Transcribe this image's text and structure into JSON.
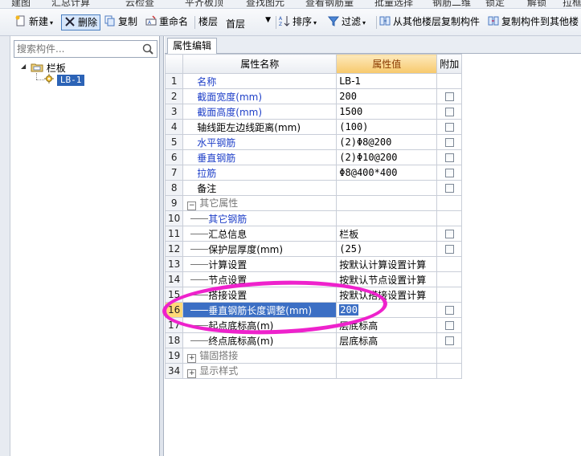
{
  "top_strip": [
    "建图",
    "汇总计算",
    "云检查",
    "平齐板顶",
    "查找图元",
    "查看钢筋量",
    "批量选择",
    "钢筋二维",
    "锁定",
    "解锁",
    "拉框"
  ],
  "toolbar": {
    "new_label": "新建",
    "delete_label": "删除",
    "copy_label": "复制",
    "rename_label": "重命名",
    "floor_label": "楼层",
    "floor_value": "首层",
    "sort_label": "排序",
    "filter_label": "过滤",
    "copy_from_label": "从其他楼层复制构件",
    "copy_to_label": "复制构件到其他楼"
  },
  "search": {
    "placeholder": "搜索构件..."
  },
  "tree": {
    "root_label": "栏板",
    "child_label": "LB-1"
  },
  "tab": {
    "label": "属性编辑"
  },
  "grid": {
    "headers": {
      "name": "属性名称",
      "value": "属性值",
      "extra": "附加"
    },
    "rows": [
      {
        "num": "1",
        "name": "名称",
        "value": "LB-1",
        "style": "blue",
        "level": 0,
        "checkbox": false
      },
      {
        "num": "2",
        "name": "截面宽度(mm)",
        "value": "200",
        "style": "blue",
        "level": 0,
        "checkbox": true
      },
      {
        "num": "3",
        "name": "截面高度(mm)",
        "value": "1500",
        "style": "blue",
        "level": 0,
        "checkbox": true
      },
      {
        "num": "4",
        "name": "轴线距左边线距离(mm)",
        "value": "(100)",
        "style": "black",
        "level": 0,
        "checkbox": true
      },
      {
        "num": "5",
        "name": "水平钢筋",
        "value": "(2)Φ8@200",
        "style": "blue",
        "level": 0,
        "checkbox": true
      },
      {
        "num": "6",
        "name": "垂直钢筋",
        "value": "(2)Φ10@200",
        "style": "blue",
        "level": 0,
        "checkbox": true
      },
      {
        "num": "7",
        "name": "拉筋",
        "value": "Φ8@400*400",
        "style": "blue",
        "level": 0,
        "checkbox": true
      },
      {
        "num": "8",
        "name": "备注",
        "value": "",
        "style": "black",
        "level": 0,
        "checkbox": true
      },
      {
        "num": "9",
        "name": "其它属性",
        "value": "",
        "style": "gray",
        "level": -1,
        "expander": "−",
        "checkbox": false
      },
      {
        "num": "10",
        "name": "其它钢筋",
        "value": "",
        "style": "blue",
        "level": 1,
        "checkbox": false
      },
      {
        "num": "11",
        "name": "汇总信息",
        "value": "栏板",
        "style": "black",
        "level": 1,
        "checkbox": true
      },
      {
        "num": "12",
        "name": "保护层厚度(mm)",
        "value": "(25)",
        "style": "black",
        "level": 1,
        "checkbox": true
      },
      {
        "num": "13",
        "name": "计算设置",
        "value": "按默认计算设置计算",
        "style": "black",
        "level": 1,
        "checkbox": false
      },
      {
        "num": "14",
        "name": "节点设置",
        "value": "按默认节点设置计算",
        "style": "black",
        "level": 1,
        "checkbox": false
      },
      {
        "num": "15",
        "name": "搭接设置",
        "value": "按默认搭接设置计算",
        "style": "black",
        "level": 1,
        "checkbox": false
      },
      {
        "num": "16",
        "name": "垂直钢筋长度调整(mm)",
        "value": "200",
        "style": "black",
        "level": 1,
        "checkbox": true,
        "selected": true
      },
      {
        "num": "17",
        "name": "起点底标高(m)",
        "value": "层底标高",
        "style": "black",
        "level": 1,
        "checkbox": true
      },
      {
        "num": "18",
        "name": "终点底标高(m)",
        "value": "层底标高",
        "style": "black",
        "level": 1,
        "checkbox": true
      },
      {
        "num": "19",
        "name": "锚固搭接",
        "value": "",
        "style": "gray",
        "level": -1,
        "expander": "+",
        "checkbox": false
      },
      {
        "num": "34",
        "name": "显示样式",
        "value": "",
        "style": "gray",
        "level": -1,
        "expander": "+",
        "checkbox": false
      }
    ]
  },
  "colors": {
    "accent_blue": "#1e3fc8",
    "selection": "#3c6fc4",
    "header_highlight": "#f7c96c",
    "annotation_ring": "#ee22cc"
  }
}
